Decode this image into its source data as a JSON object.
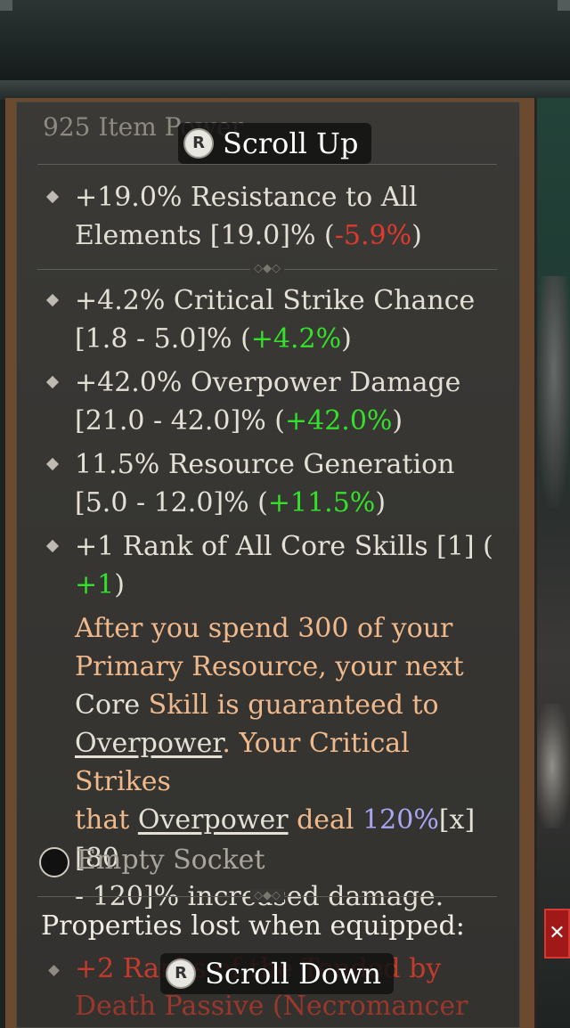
{
  "item_power": "925 Item Power",
  "scroll_up": {
    "button": "R",
    "label": "Scroll Up"
  },
  "scroll_down": {
    "button": "R",
    "label": "Scroll Down"
  },
  "implicit": {
    "line1": "+19.0% Resistance to All",
    "line2_pre": "Elements [19.0]% (",
    "line2_delta": "-5.9%",
    "line2_post": ")"
  },
  "affixes": [
    {
      "line1": "+4.2% Critical Strike Chance",
      "line2_pre": "[1.8 - 5.0]% (",
      "delta": "+4.2%",
      "post": ")"
    },
    {
      "line1": "+42.0% Overpower Damage",
      "line2_pre": "[21.0 - 42.0]% (",
      "delta": "+42.0%",
      "post": ")"
    },
    {
      "line1": "11.5% Resource Generation",
      "line2_pre": "[5.0 - 12.0]% (",
      "delta": "+11.5%",
      "post": ")"
    },
    {
      "line1": "+1 Rank of All Core Skills [1] (",
      "line2_pre": "",
      "delta": "+1",
      "post": ")"
    }
  ],
  "legendary": {
    "t1": "After you spend 300 of your",
    "t2": "Primary Resource, your next",
    "t3a": "Core",
    "t3b": " Skill is guaranteed to",
    "t4a": "Overpower",
    "t4b": ". Your Critical Strikes",
    "t5a": "that ",
    "t5b": "Overpower",
    "t5c": " deal ",
    "t5d": "120%",
    "t5e": "[x] [80",
    "t6": "- 120]% increased damage."
  },
  "socket": "Empty Socket",
  "lost": {
    "title": "Properties lost when equipped:",
    "line1": "+2 Ranks of the Tended by",
    "line2": "Death Passive (Necromancer"
  }
}
